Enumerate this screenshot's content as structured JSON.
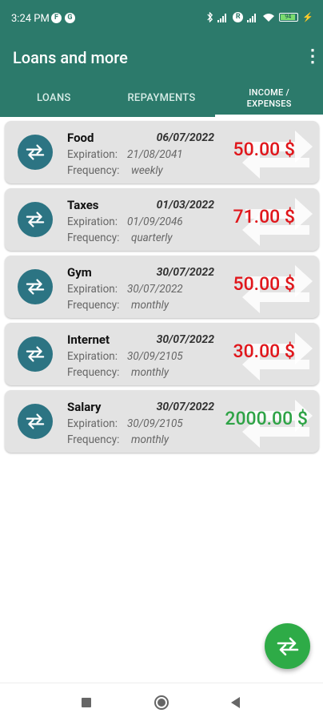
{
  "status_bar": {
    "time": "3:24 PM",
    "battery": "94"
  },
  "app_bar": {
    "title": "Loans and more",
    "more_icon": "⋮"
  },
  "tabs": [
    {
      "label": "LOANS",
      "active": false
    },
    {
      "label": "REPAYMENTS",
      "active": false
    },
    {
      "label": "INCOME /\nEXPENSES",
      "active": true
    }
  ],
  "labels": {
    "expiration": "Expiration:",
    "frequency": "Frequency:"
  },
  "items": [
    {
      "name": "Food",
      "date": "06/07/2022",
      "expiration": "21/08/2041",
      "frequency": "weekly",
      "amount": "50.00 $",
      "type": "expense"
    },
    {
      "name": "Taxes",
      "date": "01/03/2022",
      "expiration": "01/09/2046",
      "frequency": "quarterly",
      "amount": "71.00 $",
      "type": "expense"
    },
    {
      "name": "Gym",
      "date": "30/07/2022",
      "expiration": "30/07/2022",
      "frequency": "monthly",
      "amount": "50.00 $",
      "type": "expense"
    },
    {
      "name": "Internet",
      "date": "30/07/2022",
      "expiration": "30/09/2105",
      "frequency": "monthly",
      "amount": "30.00 $",
      "type": "expense"
    },
    {
      "name": "Salary",
      "date": "30/07/2022",
      "expiration": "30/09/2105",
      "frequency": "monthly",
      "amount": "2000.00 $",
      "type": "income"
    }
  ],
  "colors": {
    "primary": "#2c7a6b",
    "icon_circle": "#2c7483",
    "fab": "#2eab47",
    "expense": "#e0161b",
    "income": "#2ea346"
  }
}
